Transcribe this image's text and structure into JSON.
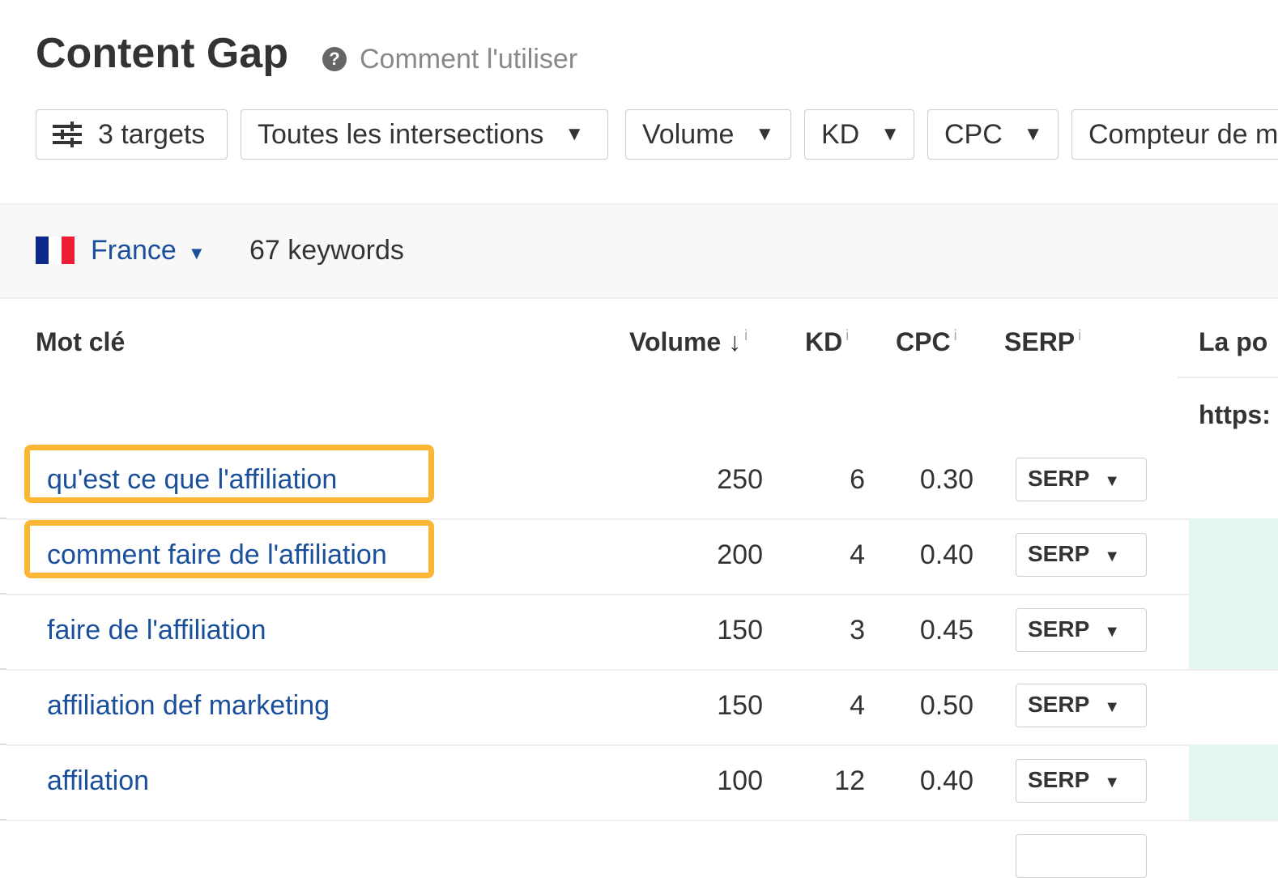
{
  "header": {
    "title": "Content Gap",
    "help_link": "Comment l'utiliser"
  },
  "filters": {
    "targets": "3 targets",
    "intersections": "Toutes les intersections",
    "volume": "Volume",
    "kd": "KD",
    "cpc": "CPC",
    "counter": "Compteur de m"
  },
  "country": {
    "name": "France",
    "keyword_count": "67 keywords"
  },
  "table": {
    "headers": {
      "keyword": "Mot clé",
      "volume": "Volume ↓",
      "kd": "KD",
      "cpc": "CPC",
      "serp": "SERP",
      "position": "La po",
      "info": "i",
      "target_url": "https:"
    },
    "rows": [
      {
        "keyword": "qu'est ce que l'affiliation",
        "volume": "250",
        "kd": "6",
        "cpc": "0.30",
        "serp": "SERP",
        "highlighted": true,
        "green": false
      },
      {
        "keyword": "comment faire de l'affiliation",
        "volume": "200",
        "kd": "4",
        "cpc": "0.40",
        "serp": "SERP",
        "highlighted": true,
        "green": true
      },
      {
        "keyword": "faire de l'affiliation",
        "volume": "150",
        "kd": "3",
        "cpc": "0.45",
        "serp": "SERP",
        "highlighted": false,
        "green": true
      },
      {
        "keyword": "affiliation def marketing",
        "volume": "150",
        "kd": "4",
        "cpc": "0.50",
        "serp": "SERP",
        "highlighted": false,
        "green": false
      },
      {
        "keyword": "affilation",
        "volume": "100",
        "kd": "12",
        "cpc": "0.40",
        "serp": "SERP",
        "highlighted": false,
        "green": true
      }
    ]
  },
  "colors": {
    "highlight": "#fbb734",
    "link": "#1a4f9c",
    "green_cell": "#e5f7ee"
  }
}
